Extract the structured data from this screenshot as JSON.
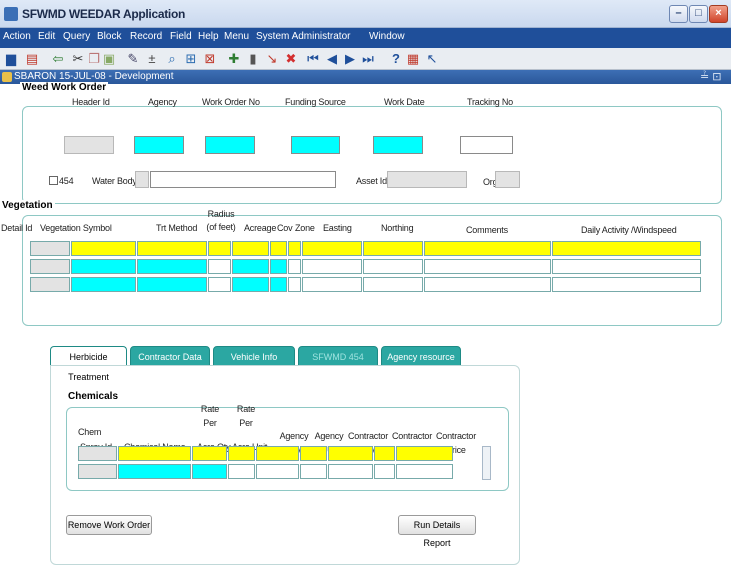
{
  "window": {
    "title": "SFWMD WEEDAR Application"
  },
  "menu": [
    "Action",
    "Edit",
    "Query",
    "Block",
    "Record",
    "Field",
    "Help",
    "Menu",
    "System Administrator",
    "Window"
  ],
  "toolbar_icons": [
    "save-icon",
    "print-icon",
    "exit-icon",
    "cut-icon",
    "copy-icon",
    "paste-icon",
    "edit-icon",
    "insert-record-icon",
    "enter-query-icon",
    "execute-query-icon",
    "cancel-query-icon",
    "new-record-icon",
    "delete-record-icon",
    "clear-record-icon",
    "remove-record-icon",
    "first-record-icon",
    "previous-record-icon",
    "next-record-icon",
    "last-record-icon",
    "help-icon",
    "keys-icon",
    "whats-this-icon"
  ],
  "form": {
    "title": "SBARON  15-JUL-08 - Development",
    "controls": "≟ ⊡ X"
  },
  "weed_work_order": {
    "title": "Weed Work Order",
    "labels": {
      "header_id": "Header Id",
      "agency": "Agency",
      "work_order_no": "Work Order No",
      "funding_source": "Funding Source",
      "work_date": "Work Date",
      "tracking_no": "Tracking No",
      "checkbox": "454",
      "water_body": "Water Body",
      "asset_id": "Asset Id",
      "org": "Org"
    }
  },
  "vegetation": {
    "title": "Vegetation",
    "columns": {
      "detail_id": "Detail Id",
      "veg_symbol": "Vegetation Symbol",
      "trt_method": "Trt Method",
      "radius": "Radius\n(of feet)",
      "acreage": "Acreage",
      "cov": "Cov",
      "zone": "Zone",
      "easting": "Easting",
      "northing": "Northing",
      "comments": "Comments",
      "daily_activity": "Daily Activity /Windspeed"
    }
  },
  "tabs": [
    {
      "label": "Herbicide Treatment"
    },
    {
      "label": "Contractor Data"
    },
    {
      "label": "Vehicle Info"
    },
    {
      "label": "SFWMD 454"
    },
    {
      "label": "Agency resource"
    }
  ],
  "chemicals": {
    "title": "Chemicals",
    "columns": {
      "chem": "Chem",
      "spray_id": "Spray Id",
      "chemical_name": "Chemical Name",
      "rate_per": "Rate\nPer",
      "acre_qty": "Acre Qty",
      "acre_unit": "Acre Unit",
      "agency_qty": "Agency\nQty",
      "agency_unit": "Agency\nUnit",
      "contractor_qty": "Contractor\nQty",
      "contractor_unit": "Contractor\nUnit",
      "contractor_price": "Contractor\nPrice"
    }
  },
  "buttons": {
    "remove_work_order": "Remove Work Order",
    "run_details_report": "Run Details Report"
  }
}
